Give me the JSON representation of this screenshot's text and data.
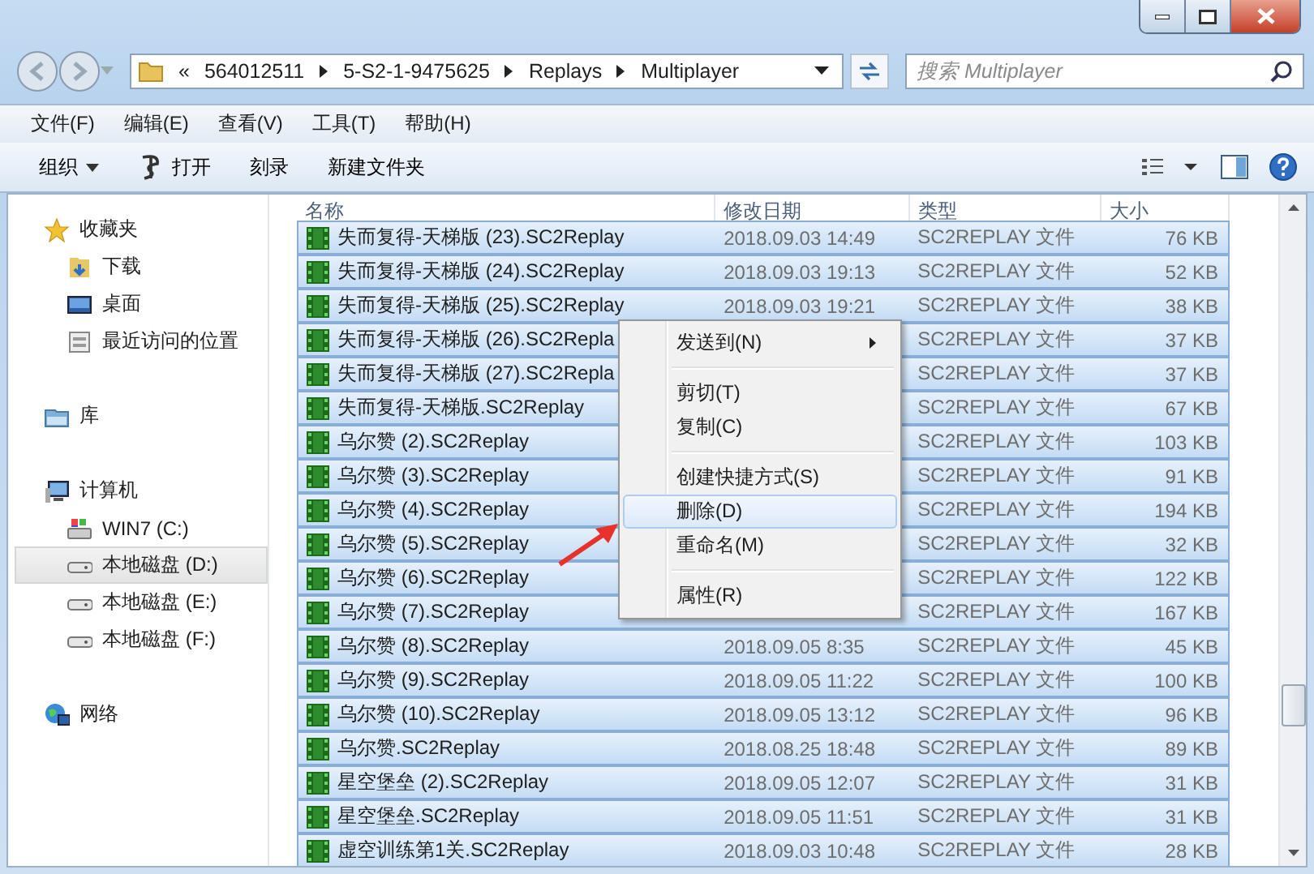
{
  "address_bar": {
    "overflow": "«",
    "crumbs": [
      "564012511",
      "5-S2-1-9475625",
      "Replays",
      "Multiplayer"
    ]
  },
  "search": {
    "placeholder": "搜索 Multiplayer"
  },
  "menu_bar": [
    "文件(F)",
    "编辑(E)",
    "查看(V)",
    "工具(T)",
    "帮助(H)"
  ],
  "toolbar": [
    {
      "label": "组织",
      "kind": "dropdown"
    },
    {
      "label": "打开",
      "kind": "icon"
    },
    {
      "label": "刻录",
      "kind": "plain"
    },
    {
      "label": "新建文件夹",
      "kind": "plain"
    }
  ],
  "nav": [
    {
      "label": "收藏夹",
      "selected": false,
      "children": [
        {
          "label": "下载",
          "selected": false
        },
        {
          "label": "桌面",
          "selected": false
        },
        {
          "label": "最近访问的位置",
          "selected": false
        }
      ]
    },
    {
      "label": "库",
      "selected": false
    },
    {
      "label": "计算机",
      "selected": false,
      "children": [
        {
          "label": "WIN7 (C:)",
          "selected": false
        },
        {
          "label": "本地磁盘 (D:)",
          "selected": true
        },
        {
          "label": "本地磁盘 (E:)",
          "selected": false
        },
        {
          "label": "本地磁盘 (F:)",
          "selected": false
        }
      ]
    },
    {
      "label": "网络",
      "selected": false
    }
  ],
  "table": {
    "columns": [
      "名称",
      "修改日期",
      "类型",
      "大小"
    ],
    "rows": [
      {
        "name": "失而复得-天梯版 (23).SC2Replay",
        "date": "2018.09.03 14:49",
        "type": "SC2REPLAY 文件",
        "size": "76 KB",
        "selected": true
      },
      {
        "name": "失而复得-天梯版 (24).SC2Replay",
        "date": "2018.09.03 19:13",
        "type": "SC2REPLAY 文件",
        "size": "52 KB",
        "selected": true
      },
      {
        "name": "失而复得-天梯版 (25).SC2Replay",
        "date": "2018.09.03 19:21",
        "type": "SC2REPLAY 文件",
        "size": "38 KB",
        "selected": true
      },
      {
        "name": "失而复得-天梯版 (26).SC2Repla",
        "type": "SC2REPLAY 文件",
        "size": "37 KB",
        "selected": true
      },
      {
        "name": "失而复得-天梯版 (27).SC2Repla",
        "type": "SC2REPLAY 文件",
        "size": "37 KB",
        "selected": true
      },
      {
        "name": "失而复得-天梯版.SC2Replay",
        "type": "SC2REPLAY 文件",
        "size": "67 KB",
        "selected": true
      },
      {
        "name": "乌尔赞 (2).SC2Replay",
        "type": "SC2REPLAY 文件",
        "size": "103 KB",
        "selected": true
      },
      {
        "name": "乌尔赞 (3).SC2Replay",
        "type": "SC2REPLAY 文件",
        "size": "91 KB",
        "selected": true
      },
      {
        "name": "乌尔赞 (4).SC2Replay",
        "type": "SC2REPLAY 文件",
        "size": "194 KB",
        "selected": true
      },
      {
        "name": "乌尔赞 (5).SC2Replay",
        "type": "SC2REPLAY 文件",
        "size": "32 KB",
        "selected": true
      },
      {
        "name": "乌尔赞 (6).SC2Replay",
        "type": "SC2REPLAY 文件",
        "size": "122 KB",
        "selected": true
      },
      {
        "name": "乌尔赞 (7).SC2Replay",
        "type": "SC2REPLAY 文件",
        "size": "167 KB",
        "selected": true
      },
      {
        "name": "乌尔赞 (8).SC2Replay",
        "date": "2018.09.05 8:35",
        "type": "SC2REPLAY 文件",
        "size": "45 KB",
        "selected": true
      },
      {
        "name": "乌尔赞 (9).SC2Replay",
        "date": "2018.09.05 11:22",
        "type": "SC2REPLAY 文件",
        "size": "100 KB",
        "selected": true
      },
      {
        "name": "乌尔赞 (10).SC2Replay",
        "date": "2018.09.05 13:12",
        "type": "SC2REPLAY 文件",
        "size": "96 KB",
        "selected": true
      },
      {
        "name": "乌尔赞.SC2Replay",
        "date": "2018.08.25 18:48",
        "type": "SC2REPLAY 文件",
        "size": "89 KB",
        "selected": true
      },
      {
        "name": "星空堡垒 (2).SC2Replay",
        "date": "2018.09.05 12:07",
        "type": "SC2REPLAY 文件",
        "size": "31 KB",
        "selected": true
      },
      {
        "name": "星空堡垒.SC2Replay",
        "date": "2018.09.05 11:51",
        "type": "SC2REPLAY 文件",
        "size": "31 KB",
        "selected": true
      },
      {
        "name": "虚空训练第1关.SC2Replay",
        "date": "2018.09.03 10:48",
        "type": "SC2REPLAY 文件",
        "size": "28 KB",
        "selected": true
      }
    ]
  },
  "context_menu": {
    "groups": [
      [
        {
          "label": "发送到(N)",
          "submenu": true,
          "selected": false
        }
      ],
      [
        {
          "label": "剪切(T)",
          "submenu": false,
          "selected": false
        },
        {
          "label": "复制(C)",
          "submenu": false,
          "selected": false
        }
      ],
      [
        {
          "label": "创建快捷方式(S)",
          "submenu": false,
          "selected": false
        },
        {
          "label": "删除(D)",
          "submenu": false,
          "selected": true
        },
        {
          "label": "重命名(M)",
          "submenu": false,
          "selected": false
        }
      ],
      [
        {
          "label": "属性(R)",
          "submenu": false,
          "selected": false
        }
      ]
    ]
  }
}
